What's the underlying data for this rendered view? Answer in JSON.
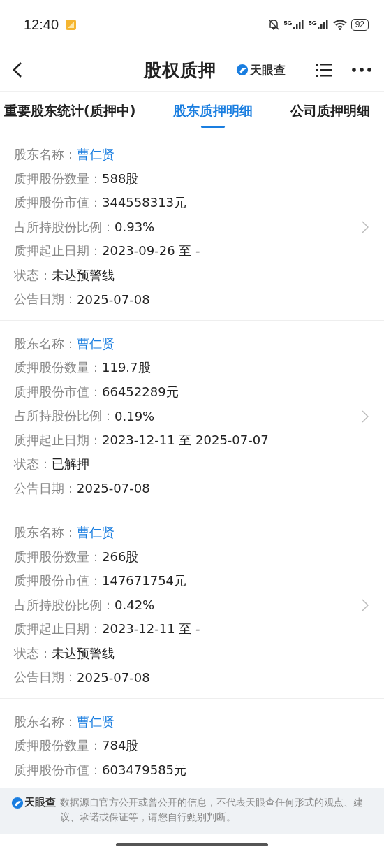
{
  "status_bar": {
    "time": "12:40",
    "network_labels": [
      "5G",
      "5G"
    ],
    "battery": "92"
  },
  "header": {
    "title": "股权质押",
    "brand": "天眼查"
  },
  "tabs": [
    {
      "label": "重要股东统计(质押中)",
      "selected": false
    },
    {
      "label": "股东质押明细",
      "selected": true
    },
    {
      "label": "公司质押明细",
      "selected": false
    }
  ],
  "records": [
    {
      "rows": [
        {
          "kind": "link",
          "label": "股东名称：",
          "value": "曹仁贤"
        },
        {
          "kind": "text",
          "label": "质押股份数量：",
          "value": "588股"
        },
        {
          "kind": "text",
          "label": "质押股份市值：",
          "value": "344558313元"
        },
        {
          "kind": "text",
          "label": "占所持股份比例：",
          "value": "0.93%"
        },
        {
          "kind": "text",
          "label": "质押起止日期：",
          "value": "2023-09-26 至 -"
        },
        {
          "kind": "text",
          "label": "状态：",
          "value": "未达预警线"
        },
        {
          "kind": "text",
          "label": "公告日期：",
          "value": "2025-07-08"
        }
      ]
    },
    {
      "rows": [
        {
          "kind": "link",
          "label": "股东名称：",
          "value": "曹仁贤"
        },
        {
          "kind": "text",
          "label": "质押股份数量：",
          "value": "119.7股"
        },
        {
          "kind": "text",
          "label": "质押股份市值：",
          "value": "66452289元"
        },
        {
          "kind": "text",
          "label": "占所持股份比例：",
          "value": "0.19%"
        },
        {
          "kind": "text",
          "label": "质押起止日期：",
          "value": "2023-12-11 至 2025-07-07"
        },
        {
          "kind": "text",
          "label": "状态：",
          "value": "已解押"
        },
        {
          "kind": "text",
          "label": "公告日期：",
          "value": "2025-07-08"
        }
      ]
    },
    {
      "rows": [
        {
          "kind": "link",
          "label": "股东名称：",
          "value": "曹仁贤"
        },
        {
          "kind": "text",
          "label": "质押股份数量：",
          "value": "266股"
        },
        {
          "kind": "text",
          "label": "质押股份市值：",
          "value": "147671754元"
        },
        {
          "kind": "text",
          "label": "占所持股份比例：",
          "value": "0.42%"
        },
        {
          "kind": "text",
          "label": "质押起止日期：",
          "value": "2023-12-11 至 -"
        },
        {
          "kind": "text",
          "label": "状态：",
          "value": "未达预警线"
        },
        {
          "kind": "text",
          "label": "公告日期：",
          "value": "2025-07-08"
        }
      ]
    },
    {
      "rows": [
        {
          "kind": "link",
          "label": "股东名称：",
          "value": "曹仁贤"
        },
        {
          "kind": "text",
          "label": "质押股份数量：",
          "value": "784股"
        },
        {
          "kind": "text",
          "label": "质押股份市值：",
          "value": "603479585元"
        }
      ]
    }
  ],
  "footer": {
    "brand": "天眼查",
    "disclaimer": "数据源自官方公开或曾公开的信息，不代表天眼查任何形式的观点、建议、承诺或保证等，请您自行甄别判断。"
  }
}
